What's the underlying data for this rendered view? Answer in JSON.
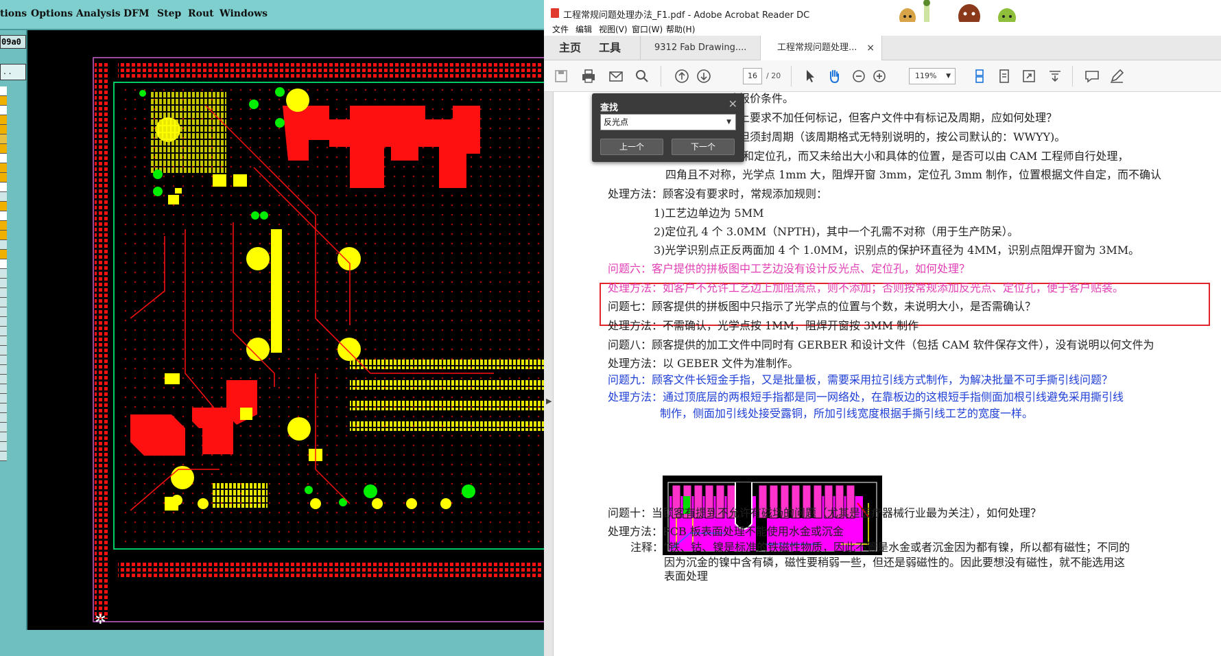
{
  "cam": {
    "menu": [
      "tions",
      "Options",
      "Analysis",
      "DFM",
      "Step",
      "Rout",
      "Windows"
    ],
    "code_label": "09a0",
    "dots_label": ". ."
  },
  "acrobat": {
    "title": "工程常规问题处理办法_F1.pdf - Adobe Acrobat Reader DC",
    "menu": [
      "文件",
      "编辑",
      "视图(V)",
      "窗口(W)",
      "帮助(H)"
    ],
    "tabs": {
      "home": "主页",
      "tools": "工具",
      "doc1": "9312 Fab Drawing....",
      "doc2": "工程常规问题处理...",
      "close": "×"
    },
    "toolbar": {
      "page_current": "16",
      "page_total": "/ 20",
      "zoom": "119%"
    },
    "find": {
      "title": "查找",
      "query": "反光点",
      "prev": "上一个",
      "next": "下一个"
    },
    "doc_lines": [
      "改报价条件。",
      "单上要求不加任何标记，但客户文件中有标记及周期，应如何处理？",
      "，但须封周期（该周期格式无特别说明的，按公司默认的：WWYY)。",
      "问题五：  客户要求加光学点和定位孔，而又未给出大小和具体的位置，是否可以由 CAM 工程师自行处理，",
      "四角且不对称，光学点 1mm 大，阻焊开窗 3mm，定位孔 3mm 制作，位置根据文件自定，而不确认",
      "处理方法：顾客没有要求时，常规添加规则：",
      "1)工艺边单边为 5MM",
      "2)定位孔 4 个 3.0MM（NPTH)，其中一个孔需不对称（用于生产防呆）。",
      "3)光学识别点正反两面加 4 个 1.0MM，识别点的保护环直径为 4MM，识别点阻焊开窗为 3MM。",
      "问题六：客户提供的拼板图中工艺边没有设计反光点、定位孔，如何处理？",
      "处理方法：如客户不允许工艺边上加阻流点，则不添加；否则按常规添加反光点、定位孔，便于客户贴装。",
      "问题七：顾客提供的拼板图中只指示了光学点的位置与个数，未说明大小，是否需确认？",
      "处理方法：不需确认，光学点按 1MM，阻焊开窗按 3MM 制作",
      "问题八：顾客提供的加工文件中同时有 GERBER 和设计文件（包括 CAM 软件保存文件），没有说明以何文件为",
      "处理方法：以 GEBER 文件为准制作。",
      "问题九：顾客文件长短金手指，又是批量板，需要采用拉引线方式制作，为解决批量不可手撕引线问题？",
      "处理方法：通过顶底层的两根短手指都是同一网络处，在靠板边的这根短手指侧面加根引线避免采用撕引线",
      "制作，侧面加引线处接受露铜，所加引线宽度根据手撕引线工艺的宽度一样。",
      "问题十：当顾客有提到不允许有磁场的问题（尤其是医疗器械行业最为关注），如何处理？",
      "处理方法：PCB 板表面处理不能使用水金或沉金",
      "注释：“铁、钴、镍是标准的铁磁性物质，因此不管是水金或者沉金因为都有镍，所以都有磁性；不同的",
      "因为沉金的镍中含有磷，磁性要稍弱一些，但还是弱磁性的。因此要想没有磁性，就不能选用这",
      "表面处理"
    ]
  },
  "colors": {
    "cam_menu_bg": "#7fcfcf",
    "pcb_red": "#ff1010",
    "pcb_yellow": "#ffff00",
    "pcb_green": "#00ee00",
    "highlight_pink": "#e23fb5",
    "highlight_blue": "#1f3fd6",
    "highlight_box": "#e0242a"
  }
}
